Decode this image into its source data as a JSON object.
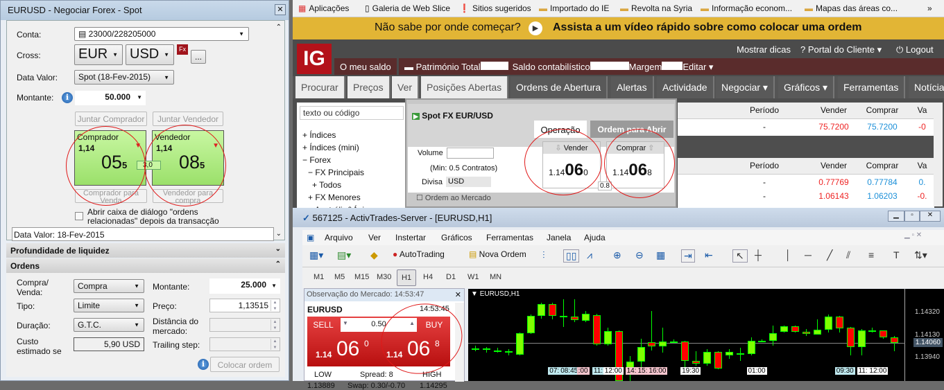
{
  "left_panel": {
    "title": "EURUSD - Negociar Forex - Spot",
    "conta_label": "Conta:",
    "conta_value": "23000/228205000",
    "cross_label": "Cross:",
    "cross_base": "EUR",
    "cross_quote": "USD",
    "fx_badge": "Fx",
    "more_button": "...",
    "data_valor_label": "Data Valor:",
    "data_valor_value": "Spot (18-Fev-2015)",
    "montante_label": "Montante:",
    "montante_value": "50.000",
    "juntar_comprador": "Juntar Comprador",
    "juntar_vendedor": "Juntar Vendedor",
    "comprador": {
      "title": "Comprador",
      "big_figure": "1,14",
      "pips": "05",
      "fraction": "5"
    },
    "vendedor": {
      "title": "Vendedor",
      "big_figure": "1,14",
      "pips": "08",
      "fraction": "5"
    },
    "spread": "3,0",
    "comprador_para_venda": "Comprador para Venda",
    "vendedor_para_compra": "Vendedor para compra",
    "checkbox_label": "Abrir caixa de diálogo \"ordens relacionadas\" depois da transacção",
    "status": "Data Valor: 18-Fev-2015",
    "section_liquidez": "Profundidade de liquidez",
    "section_ordens": "Ordens",
    "ordens": {
      "compra_venda_label": "Compra/ Venda:",
      "compra_venda_value": "Compra",
      "tipo_label": "Tipo:",
      "tipo_value": "Limite",
      "duracao_label": "Duração:",
      "duracao_value": "G.T.C.",
      "custo_label": "Custo estimado se",
      "custo_value": "5,90 USD",
      "montante_label": "Montante:",
      "montante_value": "25.000",
      "preco_label": "Preço:",
      "preco_value": "1,13515",
      "distancia_label": "Distância do mercado:",
      "trailing_label": "Trailing step:",
      "colocar_ordem": "Colocar ordem"
    }
  },
  "browser": {
    "bookmarks": [
      "Aplicações",
      "Galeria de Web Slice",
      "Sitios sugeridos",
      "Importado do IE",
      "Revolta na Syria",
      "Informação econom...",
      "Mapas das áreas co..."
    ],
    "more": "»",
    "banner_question": "Não sabe por onde começar?",
    "banner_link": "Assista a um vídeo rápido sobre como colocar uma ordem",
    "logo": "IG",
    "top_links": [
      "Mostrar dicas",
      "Portal do Cliente",
      "Logout"
    ],
    "account_bar": [
      "O meu saldo",
      "Património Total",
      "Saldo contabilístico",
      "Margem",
      "Editar"
    ],
    "nav_tabs": [
      "Procurar",
      "Preços",
      "Ver",
      "Posições Abertas",
      "Ordens de Abertura",
      "Alertas",
      "Actividade",
      "Negociar",
      "Gráficos",
      "Ferramentas",
      "Notícia"
    ],
    "search_placeholder": "texto ou código",
    "tree": [
      "Índices",
      "Índices (mini)",
      "Forex",
      "FX Principais",
      "Todos",
      "FX Menores",
      "Austrália&Ásia"
    ],
    "ticket": {
      "title": "Spot FX EUR/USD",
      "tab_operacao": "Operação",
      "tab_ordem": "Ordem para Abrir",
      "volume_label": "Volume",
      "min": "(Min: 0.5 Contratos)",
      "divisa_label": "Divisa",
      "divisa_value": "USD",
      "ordem_mercado": "Ordem ao Mercado",
      "vender": {
        "label": "Vender",
        "prefix": "1.14",
        "big": "06",
        "suffix": "0"
      },
      "comprar": {
        "label": "Comprar",
        "prefix": "1.14",
        "big": "06",
        "suffix": "8"
      },
      "spread": "0.8"
    },
    "table_headers": [
      "Período",
      "Vender",
      "Comprar",
      "Va"
    ],
    "rows1": [
      {
        "periodo": "-",
        "vender": "75.7200",
        "comprar": "75.7200",
        "var": "-0"
      }
    ],
    "rows2": [
      {
        "periodo": "-",
        "vender": "0.77769",
        "comprar": "0.77784",
        "var": "0."
      },
      {
        "periodo": "-",
        "vender": "1.06143",
        "comprar": "1.06203",
        "var": "-0."
      }
    ]
  },
  "mt4": {
    "title": "567125 - ActivTrades-Server - [EURUSD,H1]",
    "menu": [
      "Arquivo",
      "Ver",
      "Instertar",
      "Gráficos",
      "Ferramentas",
      "Janela",
      "Ajuda"
    ],
    "autotrading": "AutoTrading",
    "nova_ordem": "Nova Ordem",
    "timeframes": [
      "M1",
      "M5",
      "M15",
      "M30",
      "H1",
      "H4",
      "D1",
      "W1",
      "MN"
    ],
    "active_timeframe": "H1",
    "market_watch": {
      "title": "Observação do Mercado: 14:53:47",
      "symbol": "EURUSD",
      "time": "14:53:45",
      "sell": "SELL",
      "buy": "BUY",
      "lot": "0.50",
      "sell_price": {
        "prefix": "1.14",
        "big": "06",
        "sup": "0"
      },
      "buy_price": {
        "prefix": "1.14",
        "big": "06",
        "sup": "8"
      },
      "low_label": "LOW",
      "spread": "Spread: 8",
      "high_label": "HIGH",
      "low": "1.13889",
      "swap": "Swap: 0.30/-0.70",
      "high": "1.14295"
    },
    "chart_label": "EURUSD,H1"
  },
  "chart_data": {
    "type": "candlestick",
    "title": "EURUSD,H1",
    "ylim": [
      1.13741,
      1.14519
    ],
    "y_ticks": [
      "1.14320",
      "1.14130",
      "1.13940"
    ],
    "current_price": "1.14060",
    "candles": [
      [
        1.14004,
        1.14014,
        1.1404,
        1.1399
      ],
      [
        1.14014,
        1.14004,
        1.1403,
        1.1398
      ],
      [
        1.14,
        1.14,
        1.1402,
        1.1398
      ],
      [
        1.13991,
        1.1398,
        1.1401,
        1.1396
      ],
      [
        1.13965,
        1.14145,
        1.1415,
        1.1396
      ],
      [
        1.14145,
        1.14291,
        1.143,
        1.1414
      ],
      [
        1.14291,
        1.1439,
        1.144,
        1.1427
      ],
      [
        1.1439,
        1.14291,
        1.144,
        1.1426
      ],
      [
        1.14288,
        1.14291,
        1.1443,
        1.142
      ],
      [
        1.14283,
        1.14254,
        1.1443,
        1.1424
      ],
      [
        1.14248,
        1.14306,
        1.1433,
        1.1424
      ],
      [
        1.14297,
        1.14049,
        1.1431,
        1.1404
      ],
      [
        1.14049,
        1.1416,
        1.1419,
        1.1404
      ],
      [
        1.1416,
        1.13741,
        1.1417,
        1.13741
      ],
      [
        1.138,
        1.13907,
        1.1395,
        1.13741
      ],
      [
        1.13903,
        1.14028,
        1.141,
        1.1385
      ],
      [
        1.14069,
        1.14033,
        1.1433,
        1.14
      ],
      [
        1.14033,
        1.14076,
        1.1419,
        1.1398
      ],
      [
        1.14072,
        1.14072,
        1.1409,
        1.1406
      ],
      [
        1.14072,
        1.13911,
        1.1408,
        1.1386
      ],
      [
        1.13911,
        1.13885,
        1.1399,
        1.1387
      ],
      [
        1.13885,
        1.13985,
        1.1401,
        1.1387
      ],
      [
        1.13985,
        1.13844,
        1.1399,
        1.1384
      ],
      [
        1.13959,
        1.13985,
        1.1401,
        1.1393
      ],
      [
        1.13975,
        1.13975,
        1.1402,
        1.1391
      ],
      [
        1.13971,
        1.14082,
        1.1411,
        1.1396
      ],
      [
        1.14082,
        1.14082,
        1.1409,
        1.1407
      ],
      [
        1.14082,
        1.14145,
        1.1421,
        1.1404
      ],
      [
        1.14154,
        1.14201,
        1.1421,
        1.1415
      ],
      [
        1.14201,
        1.14154,
        1.1421,
        1.1415
      ],
      [
        1.14154,
        1.14139,
        1.1418,
        1.1412
      ],
      [
        1.14135,
        1.14174,
        1.1426,
        1.1413
      ],
      [
        1.14174,
        1.14285,
        1.143,
        1.1415
      ],
      [
        1.14285,
        1.14185,
        1.1429,
        1.1415
      ],
      [
        1.14189,
        1.1403,
        1.142,
        1.1396
      ],
      [
        1.1403,
        1.14166,
        1.1418,
        1.1396
      ],
      [
        1.14166,
        1.14166,
        1.1419,
        1.1415
      ],
      [
        1.14166,
        1.14108,
        1.1417,
        1.141
      ],
      [
        1.14108,
        1.14063,
        1.1412,
        1.1399
      ]
    ],
    "time_labels": [
      {
        "t": "07:",
        "at": 7,
        "c": "#bfe9ef"
      },
      {
        "t": "08:45",
        "at": 8,
        "c": "#bfe9ef"
      },
      {
        "t": ":00",
        "at": 9.6,
        "c": "#f7c6cf"
      },
      {
        "t": "11:",
        "at": 11,
        "c": "#bfe9ef"
      },
      {
        "t": "12:00",
        "at": 12,
        "c": "#ffffff"
      },
      {
        "t": "14:",
        "at": 14,
        "c": "#f7c6cf"
      },
      {
        "t": "15:",
        "at": 15,
        "c": "#f7c6cf"
      },
      {
        "t": "16:00",
        "at": 16,
        "c": "#f7c6cf"
      },
      {
        "t": "19:30",
        "at": 19,
        "c": "#ffffff"
      },
      {
        "t": "01:00",
        "at": 25,
        "c": "#ffffff"
      },
      {
        "t": "09:30",
        "at": 33,
        "c": "#bfe9ef"
      },
      {
        "t": "11:",
        "at": 35,
        "c": "#ffffff"
      },
      {
        "t": "12:00",
        "at": 36,
        "c": "#ffffff"
      }
    ],
    "colors": {
      "up": "#7fff00",
      "down": "#ff0000",
      "wick": "#00ff00"
    }
  }
}
